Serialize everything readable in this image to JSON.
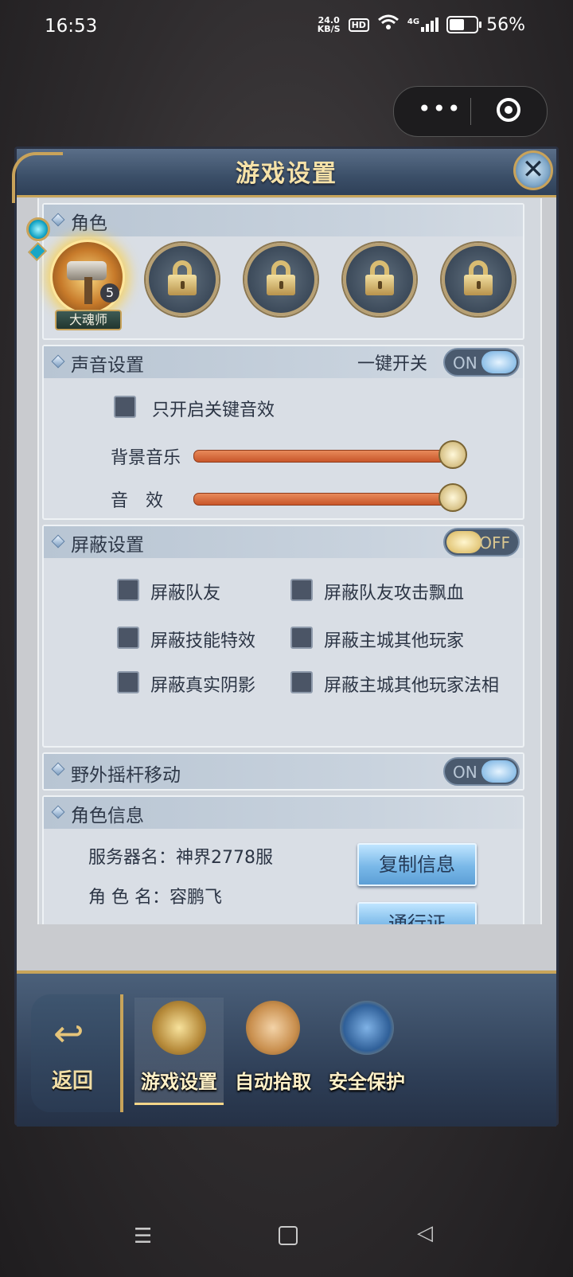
{
  "status": {
    "time": "16:53",
    "net_speed": "24.0",
    "net_unit": "KB/S",
    "hd": "HD",
    "network": "4G",
    "battery": "56%"
  },
  "capsule": {
    "more": "•••"
  },
  "panel": {
    "title": "游戏设置",
    "close": "✕"
  },
  "role": {
    "title": "角色",
    "hero_name": "大魂师",
    "hero_level": "5"
  },
  "sound": {
    "title": "声音设置",
    "master_label": "一键开关",
    "master_state": "ON",
    "key_only_label": "只开启关键音效",
    "bgm_label": "背景音乐",
    "sfx_label": "音　效",
    "bgm_level": 1.0,
    "sfx_level": 1.0
  },
  "shield": {
    "title": "屏蔽设置",
    "state": "OFF",
    "options": [
      "屏蔽队友",
      "屏蔽队友攻击飘血",
      "屏蔽技能特效",
      "屏蔽主城其他玩家",
      "屏蔽真实阴影",
      "屏蔽主城其他玩家法相"
    ]
  },
  "joystick": {
    "title": "野外摇杆移动",
    "state": "ON"
  },
  "info": {
    "title": "角色信息",
    "server_line": "服务器名：神界2778服",
    "role_line": "角 色 名：容鹏飞",
    "copy_button": "复制信息",
    "pass_button": "通行证"
  },
  "bottom": {
    "back": "返回",
    "tabs": [
      "游戏设置",
      "自动拾取",
      "安全保护"
    ]
  },
  "navbar": {
    "menu": "☰",
    "back": "◁"
  }
}
